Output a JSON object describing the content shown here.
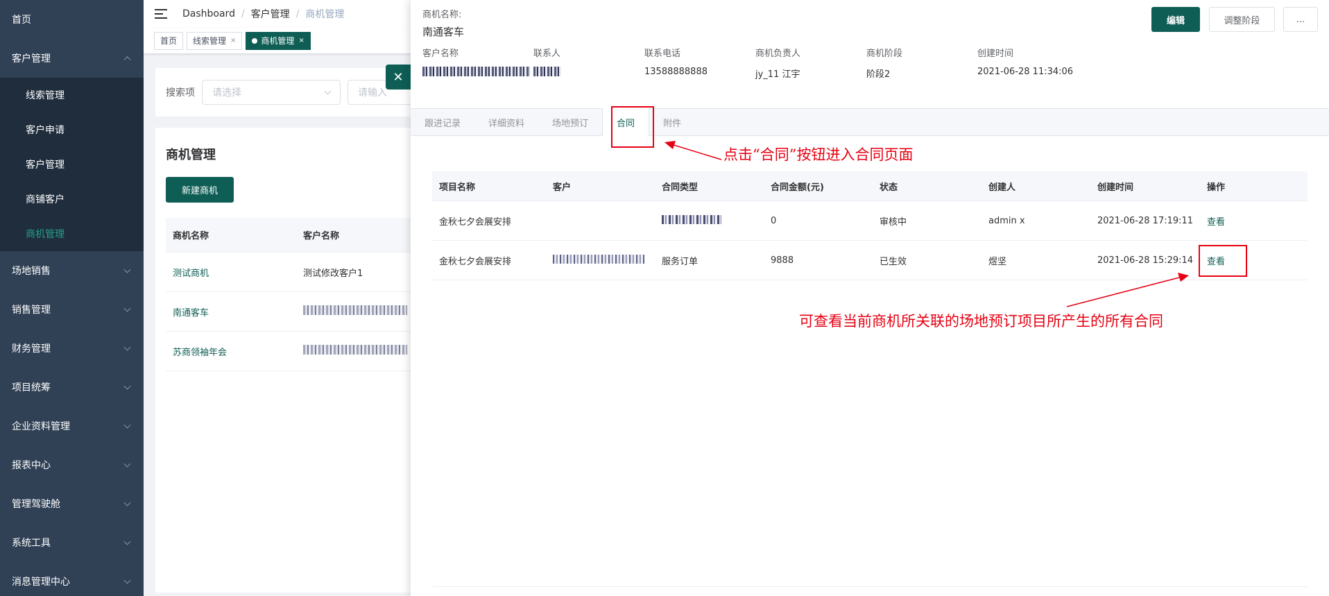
{
  "sidebar": {
    "home": "首页",
    "customer_group": "客户管理",
    "sub_items": [
      "线索管理",
      "客户申请",
      "客户管理",
      "商铺客户",
      "商机管理"
    ],
    "groups": [
      "场地销售",
      "销售管理",
      "财务管理",
      "项目统筹",
      "企业资料管理",
      "报表中心",
      "管理驾驶舱",
      "系统工具",
      "消息管理中心"
    ]
  },
  "breadcrumb": [
    "Dashboard",
    "客户管理",
    "商机管理"
  ],
  "tags": {
    "home": "首页",
    "leads": "线索管理",
    "opportunity": "商机管理"
  },
  "search": {
    "label": "搜索项",
    "select_placeholder": "请选择",
    "input_placeholder": "请输入"
  },
  "list": {
    "title": "商机管理",
    "new_button": "新建商机",
    "headers": [
      "商机名称",
      "客户名称"
    ],
    "rows": [
      {
        "name": "测试商机",
        "customer": "测试修改客户1"
      },
      {
        "name": "南通客车"
      },
      {
        "name": "苏商领袖年会"
      }
    ]
  },
  "drawer": {
    "name_label": "商机名称:",
    "name_value": "南通客车",
    "buttons": {
      "edit": "编辑",
      "stage": "调整阶段",
      "more": "..."
    },
    "info": [
      {
        "key": "客户名称"
      },
      {
        "key": "联系人"
      },
      {
        "key": "联系电话",
        "value": "13588888888"
      },
      {
        "key": "商机负责人",
        "value": "jy_11 江宇"
      },
      {
        "key": "商机阶段",
        "value": "阶段2"
      },
      {
        "key": "创建时间",
        "value": "2021-06-28 11:34:06"
      }
    ],
    "tabs": [
      "跟进记录",
      "详细资料",
      "场地预订",
      "合同",
      "附件"
    ],
    "contracts": {
      "headers": [
        "项目名称",
        "客户",
        "合同类型",
        "合同金额(元)",
        "状态",
        "创建人",
        "创建时间",
        "操作"
      ],
      "rows": [
        {
          "project": "金秋七夕会展安排",
          "customer": "",
          "type": "",
          "amount": "0",
          "status": "审核中",
          "creator": "admin x",
          "created": "2021-06-28 17:19:11",
          "action": "查看"
        },
        {
          "project": "金秋七夕会展安排",
          "customer": "",
          "type": "服务订单",
          "amount": "9888",
          "status": "已生效",
          "creator": "煜坚",
          "created": "2021-06-28 15:29:14",
          "action": "查看"
        }
      ]
    }
  },
  "annotations": {
    "tab_note": "点击“合同”按钮进入合同页面",
    "view_note": "可查看当前商机所关联的场地预订项目所产生的所有合同"
  },
  "colors": {
    "primary": "#0e5e55",
    "sidebar": "#304156",
    "annotation": "#e60012"
  }
}
